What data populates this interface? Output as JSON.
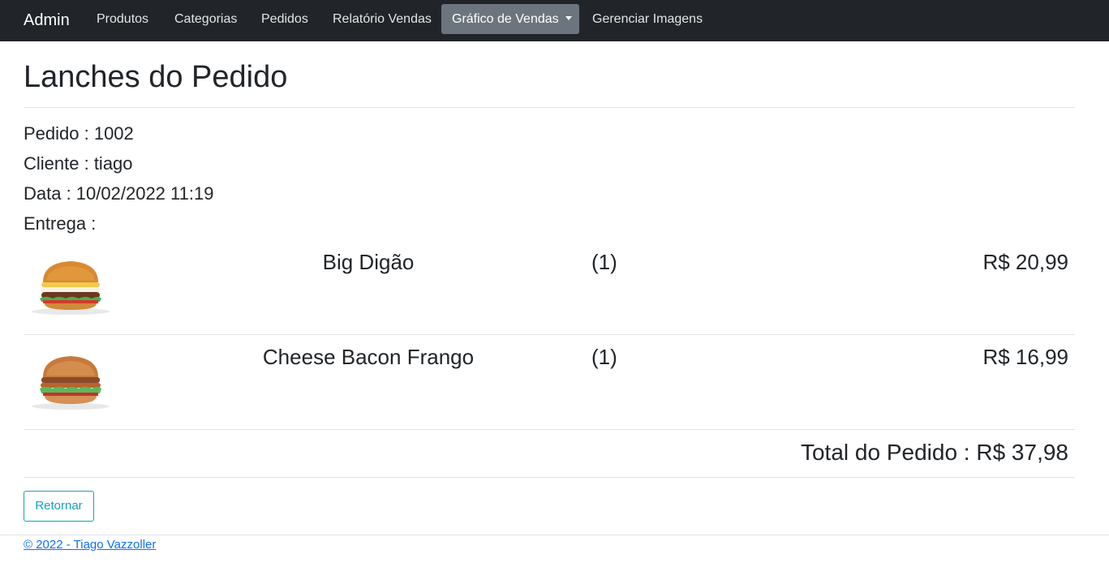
{
  "navbar": {
    "brand": "Admin",
    "items": [
      {
        "label": "Produtos"
      },
      {
        "label": "Categorias"
      },
      {
        "label": "Pedidos"
      },
      {
        "label": "Relatório Vendas"
      },
      {
        "label": "Gráfico de Vendas",
        "active": true,
        "dropdown": true
      },
      {
        "label": "Gerenciar Imagens"
      }
    ]
  },
  "page": {
    "title": "Lanches do Pedido"
  },
  "order": {
    "pedido": "Pedido : 1002",
    "cliente": "Cliente : tiago",
    "data": "Data : 10/02/2022 11:19",
    "entrega": "Entrega :"
  },
  "items": [
    {
      "name": "Big Digão",
      "qty": "(1)",
      "price": "R$ 20,99",
      "image_icon": "hamburger-image"
    },
    {
      "name": "Cheese Bacon Frango",
      "qty": "(1)",
      "price": "R$ 16,99",
      "image_icon": "hamburger-image"
    }
  ],
  "total": {
    "label": "Total do Pedido : R$ 37,98"
  },
  "actions": {
    "return_label": "Retornar"
  },
  "footer": {
    "text": "© 2022 - Tiago Vazzoller"
  },
  "colors": {
    "navbar_bg": "#212529",
    "active_item_bg": "#6c757d",
    "return_button": "#17a2b8",
    "footer_link": "#0d6efd"
  }
}
